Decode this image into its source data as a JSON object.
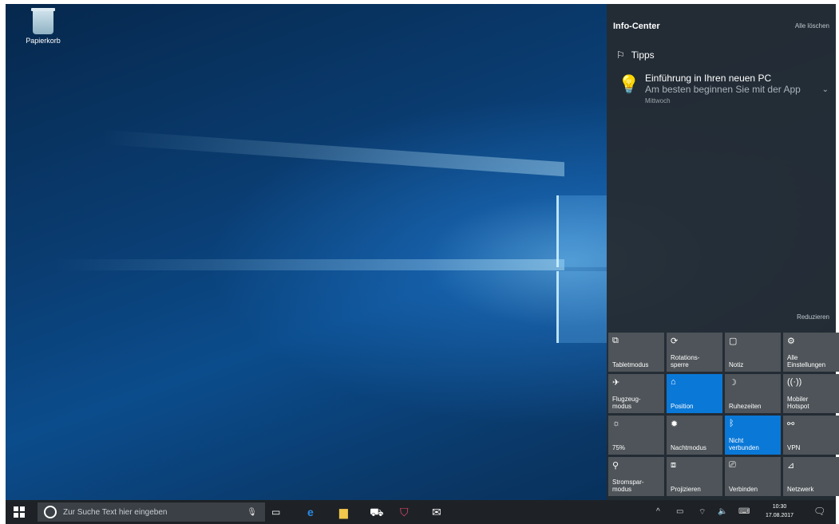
{
  "desktop": {
    "icon_label": "Papierkorb"
  },
  "info_center": {
    "title": "Info-Center",
    "clear_all": "Alle löschen",
    "group": {
      "name": "Tipps",
      "notification": {
        "title": "Einführung in Ihren neuen PC",
        "body": "Am besten beginnen Sie mit der App",
        "time": "Mittwoch"
      }
    },
    "reduce": "Reduzieren",
    "tiles": [
      {
        "icon": "tablet-icon",
        "glyph": "⧉",
        "label": "Tabletmodus",
        "active": false
      },
      {
        "icon": "rotation-icon",
        "glyph": "⟳",
        "label": "Rotations-\nsperre",
        "active": false
      },
      {
        "icon": "note-icon",
        "glyph": "▢",
        "label": "Notiz",
        "active": false
      },
      {
        "icon": "settings-icon",
        "glyph": "⚙",
        "label": "Alle\nEinstellungen",
        "active": false
      },
      {
        "icon": "airplane-icon",
        "glyph": "✈",
        "label": "Flugzeug-\nmodus",
        "active": false
      },
      {
        "icon": "location-icon",
        "glyph": "⌂",
        "label": "Position",
        "active": true
      },
      {
        "icon": "moon-icon",
        "glyph": "☽",
        "label": "Ruhezeiten",
        "active": false
      },
      {
        "icon": "hotspot-icon",
        "glyph": "((·))",
        "label": "Mobiler\nHotspot",
        "active": false
      },
      {
        "icon": "brightness-icon",
        "glyph": "☼",
        "label": "75%",
        "active": false
      },
      {
        "icon": "night-light-icon",
        "glyph": "✹",
        "label": "Nachtmodus",
        "active": false
      },
      {
        "icon": "bluetooth-icon",
        "glyph": "ᛒ",
        "label": "Nicht\nverbunden",
        "active": true
      },
      {
        "icon": "vpn-icon",
        "glyph": "⚯",
        "label": "VPN",
        "active": false
      },
      {
        "icon": "battery-saver-icon",
        "glyph": "⚲",
        "label": "Stromspar-\nmodus",
        "active": false
      },
      {
        "icon": "project-icon",
        "glyph": "⧈",
        "label": "Projizieren",
        "active": false
      },
      {
        "icon": "connect-icon",
        "glyph": "⎚",
        "label": "Verbinden",
        "active": false
      },
      {
        "icon": "network-icon",
        "glyph": "⊿",
        "label": "Netzwerk",
        "active": false
      }
    ]
  },
  "taskbar": {
    "search_placeholder": "Zur Suche Text hier eingeben",
    "time": "10:30",
    "date": "17.08.2017"
  }
}
